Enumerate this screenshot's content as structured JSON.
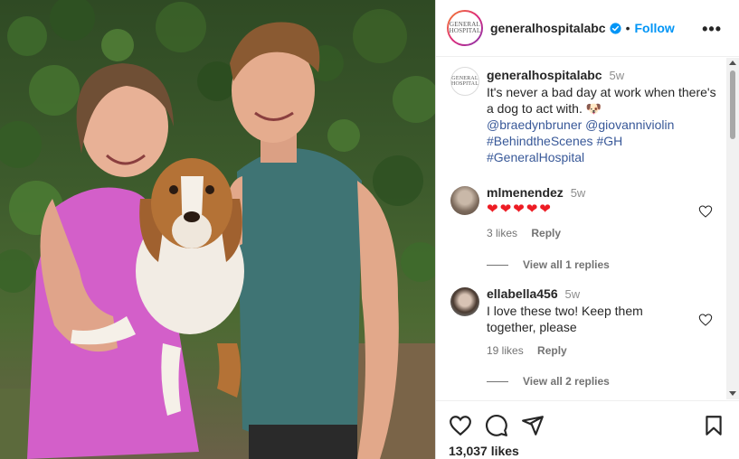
{
  "post": {
    "username": "generalhospitalabc",
    "follow_label": "Follow",
    "separator": "•",
    "more_label": "•••",
    "logo_line1": "GENERAL",
    "logo_line2": "HOSPITAL"
  },
  "caption": {
    "username": "generalhospitalabc",
    "time": "5w",
    "text": "It's never a bad day at work when there's a dog to act with.",
    "emoji": "🐶",
    "mentions": [
      "@braedynbruner",
      "@giovanniviolin"
    ],
    "hashtags": [
      "#BehindtheScenes",
      "#GH",
      "#GeneralHospital"
    ]
  },
  "comments": [
    {
      "username": "mlmenendez",
      "time": "5w",
      "text": "❤❤❤❤❤",
      "likes": "3 likes",
      "reply": "Reply",
      "view_replies": "View all 1 replies"
    },
    {
      "username": "ellabella456",
      "time": "5w",
      "text": "I love these two! Keep them together, please",
      "likes": "19 likes",
      "reply": "Reply",
      "view_replies": "View all 2 replies"
    }
  ],
  "footer": {
    "likes": "13,037 likes"
  },
  "icons": {
    "like": "heart-icon",
    "comment": "comment-icon",
    "share": "share-icon",
    "save": "bookmark-icon",
    "verified": "verified-badge-icon"
  },
  "colors": {
    "link": "#385898",
    "follow": "#0095f6",
    "verified": "#0095f6",
    "heart_red": "#ed1c24"
  }
}
